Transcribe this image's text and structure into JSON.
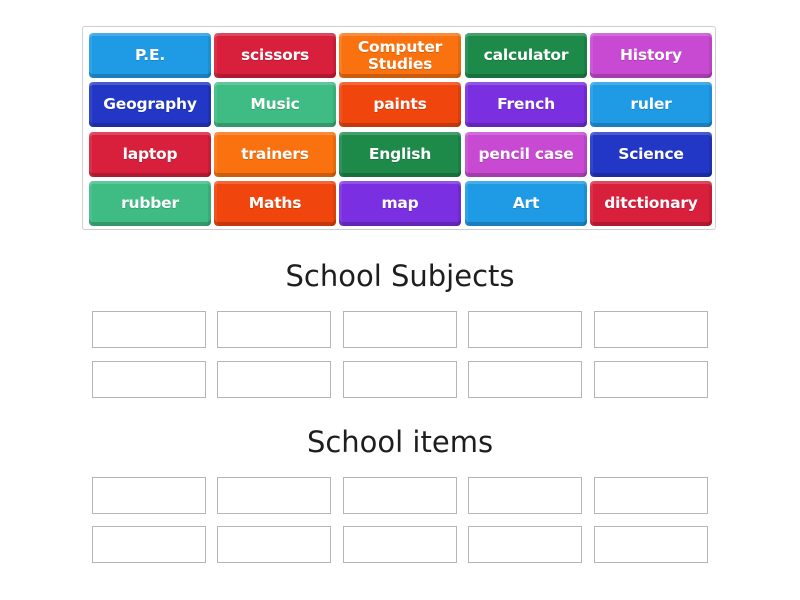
{
  "tiles": [
    {
      "label": "P.E.",
      "color": "#1f9be6"
    },
    {
      "label": "scissors",
      "color": "#d81f3b"
    },
    {
      "label": "Computer Studies",
      "color": "#f9720f"
    },
    {
      "label": "calculator",
      "color": "#1d8a4a"
    },
    {
      "label": "History",
      "color": "#c84ad3"
    },
    {
      "label": "Geography",
      "color": "#2237c5"
    },
    {
      "label": "Music",
      "color": "#3fbb84"
    },
    {
      "label": "paints",
      "color": "#f0450c"
    },
    {
      "label": "French",
      "color": "#7a2fe0"
    },
    {
      "label": "ruler",
      "color": "#1f9be6"
    },
    {
      "label": "laptop",
      "color": "#d81f3b"
    },
    {
      "label": "trainers",
      "color": "#f9720f"
    },
    {
      "label": "English",
      "color": "#1d8a4a"
    },
    {
      "label": "pencil case",
      "color": "#c84ad3"
    },
    {
      "label": "Science",
      "color": "#2237c5"
    },
    {
      "label": "rubber",
      "color": "#3fbb84"
    },
    {
      "label": "Maths",
      "color": "#f0450c"
    },
    {
      "label": "map",
      "color": "#7a2fe0"
    },
    {
      "label": "Art",
      "color": "#1f9be6"
    },
    {
      "label": "ditctionary",
      "color": "#d81f3b"
    }
  ],
  "groups": [
    {
      "title": "School Subjects",
      "slots": 10
    },
    {
      "title": "School items",
      "slots": 10
    }
  ]
}
